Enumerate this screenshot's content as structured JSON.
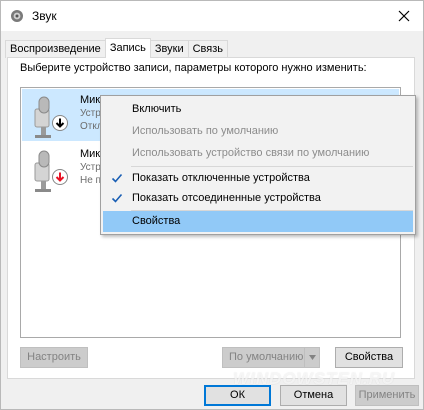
{
  "window": {
    "title": "Звук"
  },
  "tabs": [
    {
      "label": "Воспроизведение",
      "active": false
    },
    {
      "label": "Запись",
      "active": true
    },
    {
      "label": "Звуки",
      "active": false
    },
    {
      "label": "Связь",
      "active": false
    }
  ],
  "panel": {
    "instruction": "Выберите устройство записи, параметры которого нужно изменить:"
  },
  "devices": [
    {
      "name": "Мик",
      "line1": "Устр",
      "line2": "Откл",
      "selected": true,
      "status_icon": "arrow-down-black-icon"
    },
    {
      "name": "Мик",
      "line1": "Устр",
      "line2": "Не п",
      "selected": false,
      "status_icon": "arrow-down-red-icon"
    }
  ],
  "context_menu": {
    "items": [
      {
        "label": "Включить",
        "disabled": false,
        "checked": false,
        "highlighted": false
      },
      {
        "label": "Использовать по умолчанию",
        "disabled": true,
        "checked": false,
        "highlighted": false
      },
      {
        "label": "Использовать устройство связи по умолчанию",
        "disabled": true,
        "checked": false,
        "highlighted": false
      },
      {
        "label": "Показать отключенные устройства",
        "disabled": false,
        "checked": true,
        "highlighted": false
      },
      {
        "label": "Показать отсоединенные устройства",
        "disabled": false,
        "checked": true,
        "highlighted": false
      },
      {
        "label": "Свойства",
        "disabled": false,
        "checked": false,
        "highlighted": true
      }
    ]
  },
  "buttons": {
    "configure": "Настроить",
    "set_default": "По умолчанию",
    "properties": "Свойства",
    "ok": "ОК",
    "cancel": "Отмена",
    "apply": "Применить"
  },
  "watermark": "WINDOWSTEN.RU",
  "colors": {
    "selection": "#cce8ff",
    "menu_highlight": "#91c9f7",
    "default_button_border": "#0078d7",
    "status_red": "#e81123"
  }
}
